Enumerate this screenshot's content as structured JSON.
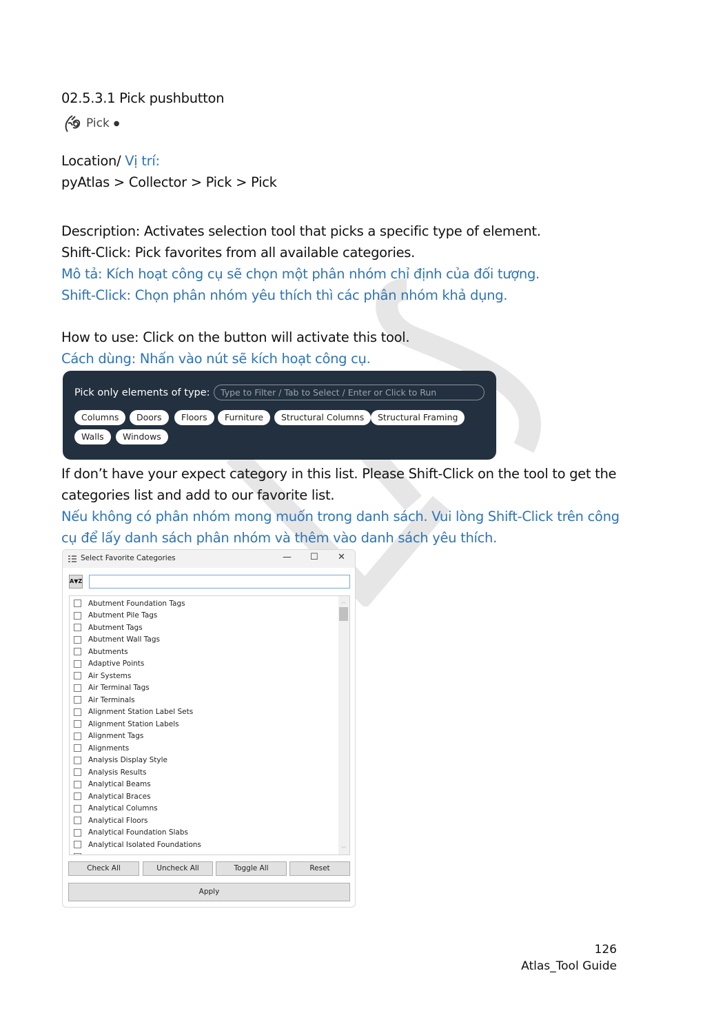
{
  "heading": "02.5.3.1 Pick pushbutton",
  "ribbon_button": {
    "icon": "ok-hand-icon",
    "label": "Pick",
    "indicator": "●"
  },
  "location": {
    "label": "Location/ ",
    "label_vi": "Vị trí:",
    "path": "pyAtlas > Collector > Pick > Pick"
  },
  "description": {
    "en1": "Description: Activates selection tool that picks a specific type of element.",
    "en2": "Shift-Click: Pick favorites from all available categories.",
    "vi1": "Mô tả: Kích hoạt công cụ sẽ chọn một phân nhóm chỉ định của đối tượng.",
    "vi2": "Shift-Click: Chọn phân nhóm yêu thích thì các phân nhóm khả dụng."
  },
  "howto": {
    "en": "How to use: Click on the button will activate this tool.",
    "vi": "Cách dùng: Nhấn vào nút sẽ kích hoạt công cụ."
  },
  "picker": {
    "label": "Pick only elements of type:",
    "placeholder": "Type to Filter / Tab to Select / Enter or Click to Run",
    "chips": [
      "Columns",
      "Doors",
      "Floors",
      "Furniture",
      "Structural Columns",
      "Structural Framing",
      "Walls",
      "Windows"
    ]
  },
  "note": {
    "en1": "If don’t have your expect category in this list. Please Shift-Click on the tool to get the",
    "en2": "categories list and add to our favorite list.",
    "vi1": "Nếu không có phân nhóm mong muốn trong danh sách. Vui lòng Shift-Click trên công",
    "vi2": "cụ để lấy danh sách phân nhóm và thêm vào danh sách yêu thích."
  },
  "dialog": {
    "title": "Select Favorite Categories",
    "filter_value": "",
    "items": [
      "Abutment Foundation Tags",
      "Abutment Pile Tags",
      "Abutment Tags",
      "Abutment Wall Tags",
      "Abutments",
      "Adaptive Points",
      "Air Systems",
      "Air Terminal Tags",
      "Air Terminals",
      "Alignment Station Label Sets",
      "Alignment Station Labels",
      "Alignment Tags",
      "Alignments",
      "Analysis Display Style",
      "Analysis Results",
      "Analytical Beams",
      "Analytical Braces",
      "Analytical Columns",
      "Analytical Floors",
      "Analytical Foundation Slabs",
      "Analytical Isolated Foundations"
    ],
    "buttons": {
      "check_all": "Check All",
      "uncheck_all": "Uncheck All",
      "toggle_all": "Toggle All",
      "reset": "Reset",
      "apply": "Apply"
    }
  },
  "footer": {
    "page": "126",
    "guide": "Atlas_Tool Guide"
  },
  "colors": {
    "accent_blue": "#2e74b5",
    "panel_bg": "#23303f"
  }
}
